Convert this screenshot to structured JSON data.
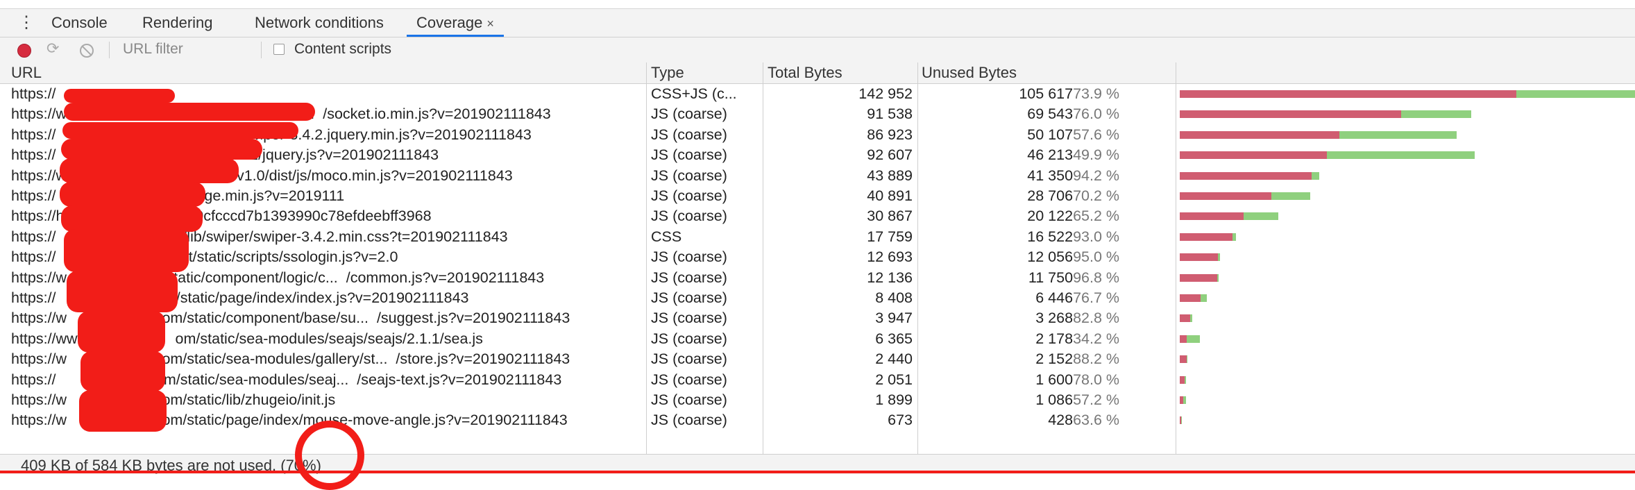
{
  "tabs": [
    {
      "label": "Console"
    },
    {
      "label": "Rendering"
    },
    {
      "label": "Network conditions"
    },
    {
      "label": "Coverage",
      "close": "×"
    }
  ],
  "toolbar": {
    "url_filter_placeholder": "URL filter",
    "content_scripts_label": "Content scripts"
  },
  "columns": {
    "url": "URL",
    "type": "Type",
    "total": "Total Bytes",
    "unused": "Unused Bytes"
  },
  "rows": [
    {
      "url": "https://",
      "type": "CSS+JS (c...",
      "total": "142 952",
      "unused": "105 617",
      "pct": "73.9 %",
      "total_bytes": 142952,
      "unused_bytes": 105617
    },
    {
      "url": "https://www.                                           .io/1....  /socket.io.min.js?v=201902111843",
      "type": "JS (coarse)",
      "total": "91 538",
      "unused": "69 543",
      "pct": "76.0 %",
      "total_bytes": 91538,
      "unused_bytes": 69543
    },
    {
      "url": "https://                               s/          /swiper-3.4.2.jquery.min.js?v=201902111843",
      "type": "JS (coarse)",
      "total": "86 923",
      "unused": "50 107",
      "pct": "57.6 %",
      "total_bytes": 86923,
      "unused_bytes": 50107
    },
    {
      "url": "https://                              jquery/1.9.1/jquery.js?v=201902111843",
      "type": "JS (coarse)",
      "total": "92 607",
      "unused": "46 213",
      "pct": "49.9 %",
      "total_bytes": 92607,
      "unused_bytes": 46213
    },
    {
      "url": "https://www                          moco/v1.0/dist/js/moco.min.js?v=201902111843",
      "type": "JS (coarse)",
      "total": "43 889",
      "unused": "41 350",
      "pct": "94.2 %",
      "total_bytes": 43889,
      "unused_bytes": 41350
    },
    {
      "url": "https://                        om/zhuge.min.js?v=2019111",
      "type": "JS (coarse)",
      "total": "40 891",
      "unused": "28 706",
      "pct": "70.2 %",
      "total_bytes": 40891,
      "unused_bytes": 28706
    },
    {
      "url": "https://h                       n.js?f0cfcccd7b1393990c78efdeebff3968",
      "type": "JS (coarse)",
      "total": "30 867",
      "unused": "20 122",
      "pct": "65.2 %",
      "total_bytes": 30867,
      "unused_bytes": 20122
    },
    {
      "url": "https://                        tatic/lib/swiper/swiper-3.4.2.min.css?t=201902111843",
      "type": "CSS",
      "total": "17 759",
      "unused": "16 522",
      "pct": "93.0 %",
      "total_bytes": 17759,
      "unused_bytes": 16522
    },
    {
      "url": "https://                         sport/static/scripts/ssologin.js?v=2.0",
      "type": "JS (coarse)",
      "total": "12 693",
      "unused": "12 056",
      "pct": "95.0 %",
      "total_bytes": 12693,
      "unused_bytes": 12056
    },
    {
      "url": "https://w                        static/component/logic/c...  /common.js?v=201902111843",
      "type": "JS (coarse)",
      "total": "12 136",
      "unused": "11 750",
      "pct": "96.8 %",
      "total_bytes": 12136,
      "unused_bytes": 11750
    },
    {
      "url": "https://                        om/static/page/index/index.js?v=201902111843",
      "type": "JS (coarse)",
      "total": "8 408",
      "unused": "6 446",
      "pct": "76.7 %",
      "total_bytes": 8408,
      "unused_bytes": 6446
    },
    {
      "url": "https://w                       om/static/component/base/su...  /suggest.js?v=201902111843",
      "type": "JS (coarse)",
      "total": "3 947",
      "unused": "3 268",
      "pct": "82.8 %",
      "total_bytes": 3947,
      "unused_bytes": 3268
    },
    {
      "url": "https://www                     om/static/sea-modules/seajs/seajs/2.1.1/sea.js",
      "type": "JS (coarse)",
      "total": "6 365",
      "unused": "2 178",
      "pct": "34.2 %",
      "total_bytes": 6365,
      "unused_bytes": 2178
    },
    {
      "url": "https://w                       om/static/sea-modules/gallery/st...  /store.js?v=201902111843",
      "type": "JS (coarse)",
      "total": "2 440",
      "unused": "2 152",
      "pct": "88.2 %",
      "total_bytes": 2440,
      "unused_bytes": 2152
    },
    {
      "url": "https://                        om/static/sea-modules/seaj...  /seajs-text.js?v=201902111843",
      "type": "JS (coarse)",
      "total": "2 051",
      "unused": "1 600",
      "pct": "78.0 %",
      "total_bytes": 2051,
      "unused_bytes": 1600
    },
    {
      "url": "https://w                       om/static/lib/zhugeio/init.js",
      "type": "JS (coarse)",
      "total": "1 899",
      "unused": "1 086",
      "pct": "57.2 %",
      "total_bytes": 1899,
      "unused_bytes": 1086
    },
    {
      "url": "https://w                       om/static/page/index/mouse-move-angle.js?v=201902111843",
      "type": "JS (coarse)",
      "total": "673",
      "unused": "428",
      "pct": "63.6 %",
      "total_bytes": 673,
      "unused_bytes": 428
    }
  ],
  "footer": "409 KB of 584 KB bytes are not used. (70%)",
  "colors": {
    "unused_bar": "#d05d71",
    "used_bar": "#8fd07e",
    "redaction": "#f21d18"
  }
}
